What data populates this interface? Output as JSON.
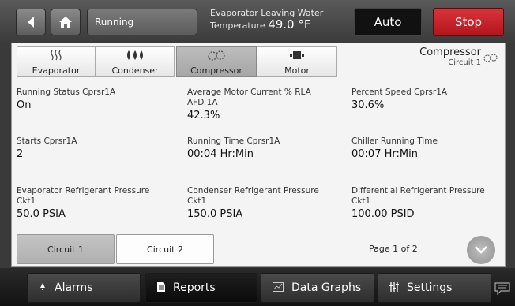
{
  "header": {
    "status": "Running",
    "evap_label_line1": "Evaporator Leaving Water",
    "evap_label_line2": "Temperature",
    "evap_value": "49.0 °F",
    "auto_label": "Auto",
    "stop_label": "Stop"
  },
  "tabs": [
    {
      "label": "Evaporator",
      "icon": "evaporator-icon"
    },
    {
      "label": "Condenser",
      "icon": "condenser-icon"
    },
    {
      "label": "Compressor",
      "icon": "compressor-icon",
      "active": true
    },
    {
      "label": "Motor",
      "icon": "motor-icon"
    }
  ],
  "section": {
    "title": "Compressor",
    "subtitle": "Circuit 1"
  },
  "fields": {
    "running_status": {
      "label": "Running Status Cprsr1A",
      "value": "On"
    },
    "avg_motor_current": {
      "label_line1": "Average Motor Current % RLA",
      "label_line2": "AFD 1A",
      "value": "42.3%"
    },
    "percent_speed": {
      "label": "Percent Speed Cprsr1A",
      "value": "30.6%"
    },
    "starts": {
      "label": "Starts Cprsr1A",
      "value": "2"
    },
    "running_time": {
      "label": "Running Time Cprsr1A",
      "value": "00:04 Hr:Min"
    },
    "chiller_running_time": {
      "label": "Chiller Running Time",
      "value": "00:07 Hr:Min"
    },
    "evap_ref_pressure": {
      "label_line1": "Evaporator Refrigerant Pressure",
      "label_line2": "Ckt1",
      "value": "50.0 PSIA"
    },
    "cond_ref_pressure": {
      "label_line1": "Condenser Refrigerant Pressure",
      "label_line2": "Ckt1",
      "value": "150.0 PSIA"
    },
    "diff_ref_pressure": {
      "label_line1": "Differential Refrigerant Pressure",
      "label_line2": "Ckt1",
      "value": "100.00 PSID"
    }
  },
  "circuits": {
    "circuit1": "Circuit 1",
    "circuit2": "Circuit 2",
    "page": "Page 1 of 2"
  },
  "nav": {
    "alarms": "Alarms",
    "reports": "Reports",
    "data_graphs": "Data Graphs",
    "settings": "Settings"
  },
  "colors": {
    "stop": "#c8222a",
    "auto": "#111111",
    "active_tab": "#b0b0b0"
  }
}
